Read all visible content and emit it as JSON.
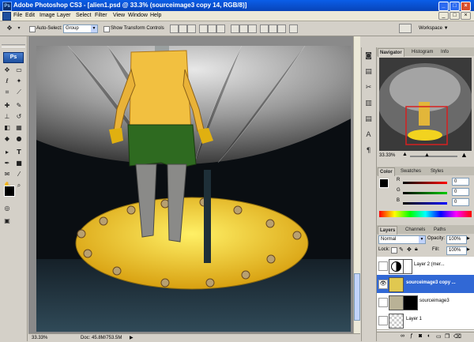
{
  "window": {
    "title": "Adobe Photoshop CS3 - [alien1.psd @ 33.3% (sourceimage3 copy 14, RGB/8)]",
    "app_icon": "Ps"
  },
  "menu": [
    "File",
    "Edit",
    "Image",
    "Layer",
    "Select",
    "Filter",
    "View",
    "Window",
    "Help"
  ],
  "options": {
    "auto_select_label": "Auto-Select:",
    "auto_select_value": "Group",
    "show_transform_label": "Show Transform Controls",
    "workspace_label": "Workspace"
  },
  "toolbox": {
    "logo": "Ps"
  },
  "status": {
    "zoom": "33.33%",
    "doc": "Doc: 45.8M/753.5M"
  },
  "navigator": {
    "tabs": [
      "Navigator",
      "Histogram",
      "Info"
    ],
    "zoom": "33.33%"
  },
  "color_panel": {
    "tabs": [
      "Color",
      "Swatches",
      "Styles"
    ],
    "channels": [
      {
        "label": "R",
        "value": "0",
        "color": "#d01010"
      },
      {
        "label": "G",
        "value": "0",
        "color": "#10a010"
      },
      {
        "label": "B",
        "value": "0",
        "color": "#1030d0"
      }
    ]
  },
  "layers_panel": {
    "tabs": [
      "Layers",
      "Channels",
      "Paths"
    ],
    "blend_mode": "Normal",
    "opacity_label": "Opacity:",
    "opacity": "100%",
    "lock_label": "Lock:",
    "fill_label": "Fill:",
    "fill": "100%",
    "layers": [
      {
        "name": "Layer 2 (mer...",
        "selected": false,
        "visible": false
      },
      {
        "name": "sourceimage3 copy ...",
        "selected": true,
        "visible": true
      },
      {
        "name": "sourceimage3",
        "selected": false,
        "visible": false
      },
      {
        "name": "Layer 1",
        "selected": false,
        "visible": false
      }
    ]
  },
  "colors": {
    "titlebar": "#0a5ee8",
    "selection": "#3168d5",
    "platform": "#f2d31f"
  }
}
